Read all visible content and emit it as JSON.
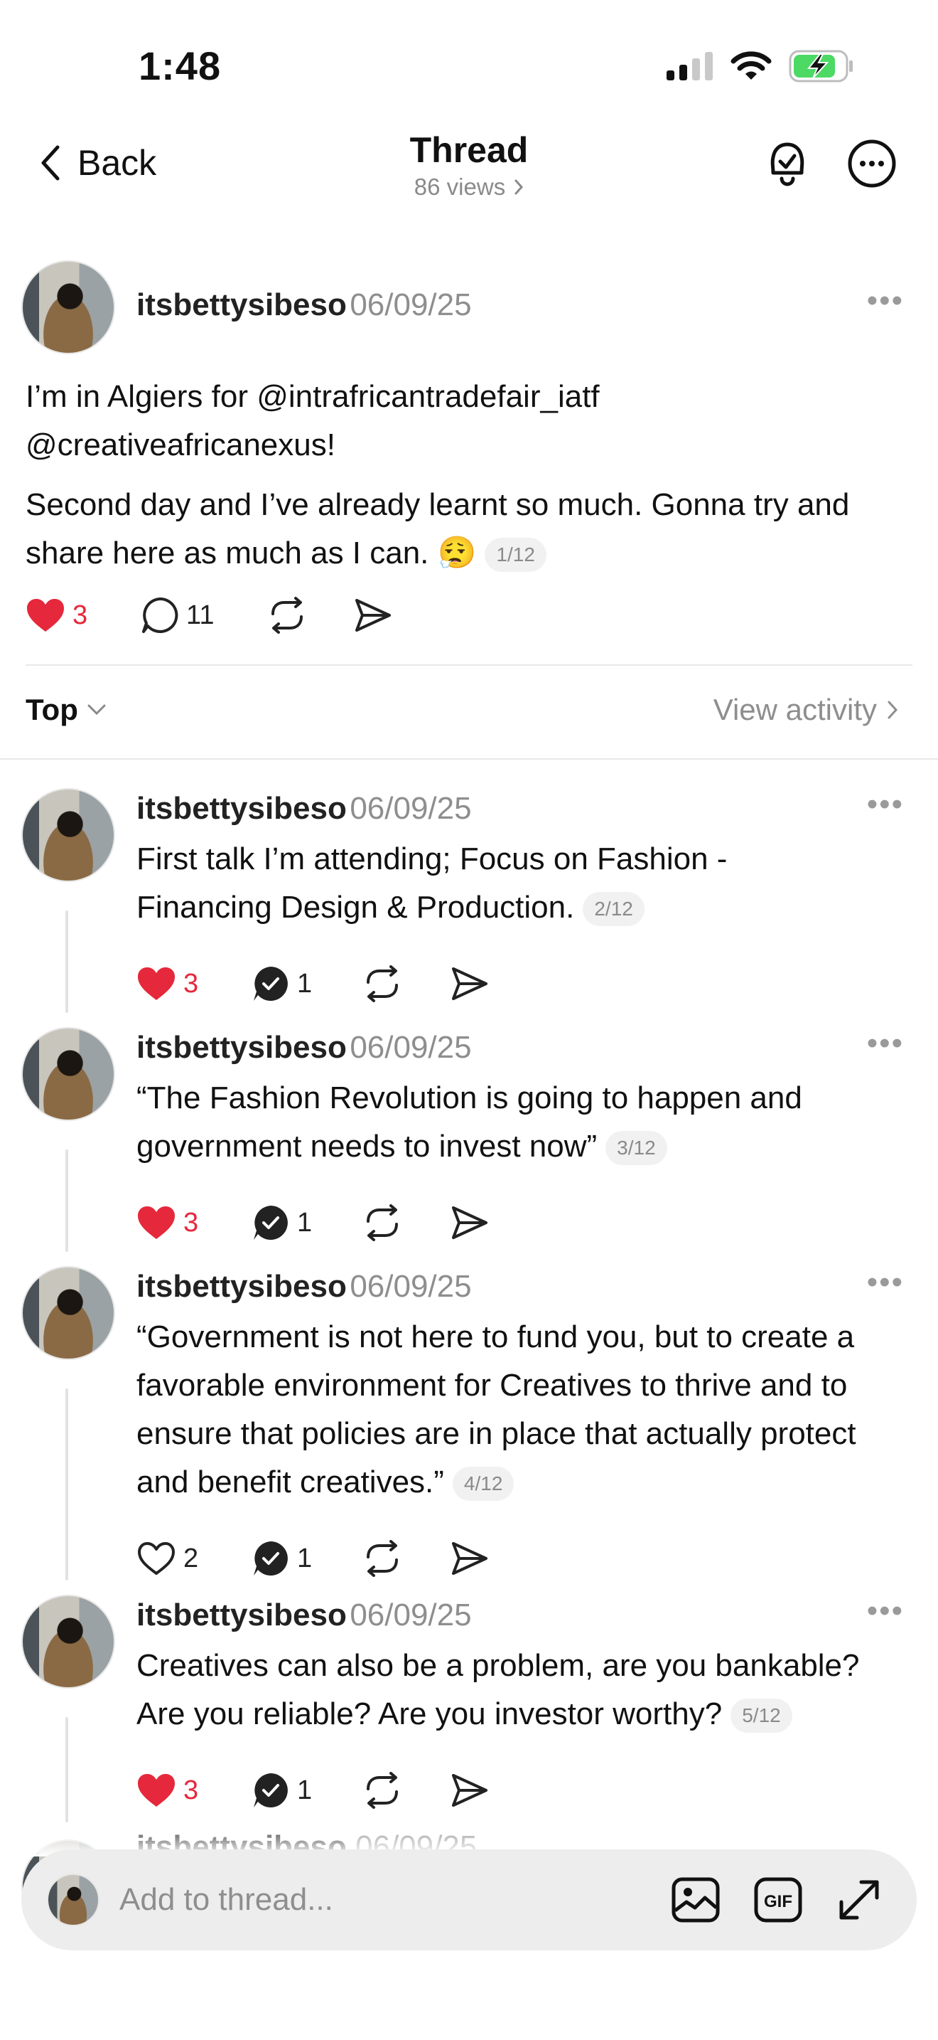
{
  "status_bar": {
    "time": "1:48"
  },
  "header": {
    "back_label": "Back",
    "title": "Thread",
    "views": "86 views"
  },
  "main_post": {
    "username": "itsbettysibeso",
    "date": "06/09/25",
    "line1": "I’m in Algiers for @intrafricantradefair_iatf",
    "line2": "@creativeafricanexus!",
    "para2_line1": "Second day and I’ve already learnt so much. Gonna try and",
    "para2_line2": "share here as much as I can.",
    "emoji": "😮‍💨",
    "counter": "1/12",
    "likes": "3",
    "replies": "11"
  },
  "sort": {
    "label": "Top",
    "view_activity": "View activity"
  },
  "replies": [
    {
      "username": "itsbettysibeso",
      "date": "06/09/25",
      "lines": [
        "First talk I’m attending;  Focus on Fashion -",
        "Financing Design & Production."
      ],
      "counter": "2/12",
      "likes": "3",
      "liked": true,
      "comments": "1"
    },
    {
      "username": "itsbettysibeso",
      "date": "06/09/25",
      "lines": [
        "“The Fashion Revolution is going to happen and",
        "government needs to invest now”"
      ],
      "counter": "3/12",
      "likes": "3",
      "liked": true,
      "comments": "1"
    },
    {
      "username": "itsbettysibeso",
      "date": "06/09/25",
      "lines": [
        "“Government is not here to fund you, but to create a",
        "favorable environment for Creatives to thrive and to",
        "ensure that policies are in place that actually protect",
        "and benefit creatives.”"
      ],
      "counter": "4/12",
      "likes": "2",
      "liked": false,
      "comments": "1"
    },
    {
      "username": "itsbettysibeso",
      "date": "06/09/25",
      "lines": [
        "Creatives can also be a problem, are you bankable?",
        "Are you reliable? Are you investor worthy?"
      ],
      "counter": "5/12",
      "likes": "3",
      "liked": true,
      "comments": "1"
    }
  ],
  "composer": {
    "placeholder": "Add to thread..."
  },
  "colors": {
    "like_red": "#e5283b",
    "muted": "#8e8e8e",
    "battery_green": "#4cd964"
  }
}
